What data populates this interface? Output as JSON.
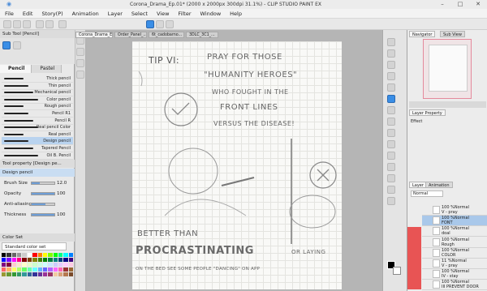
{
  "window": {
    "title": "Corona_Drama_Ep.01* (2000 x 2000px 300dpi 31.1%)  - CLIP STUDIO PAINT EX",
    "controls": [
      "–",
      "□",
      "✕"
    ]
  },
  "menu": [
    "File",
    "Edit",
    "Story(P)",
    "Animation",
    "Layer",
    "Select",
    "View",
    "Filter",
    "Window",
    "Help"
  ],
  "left_panel": {
    "header": "Sub Tool [Pencil]",
    "tabs": [
      "Pencil",
      "Pastel"
    ],
    "brushes": [
      "Thick pencil",
      "Thin pencil",
      "Mechanical pencil",
      "Color pencil",
      "Rough pencil",
      "Pencil R1",
      "Pencil R",
      "Real pencil Color",
      "Real pencil",
      "Design pencil",
      "Tapered Pencil",
      "Oil B. Pencil"
    ],
    "tool_property_header": "Tool property [Design pe...",
    "tool_property_name": "Design pencil",
    "properties": [
      {
        "label": "Brush Size",
        "value": "12.0",
        "fill": 0.35
      },
      {
        "label": "Opacity",
        "value": "100",
        "fill": 1.0
      },
      {
        "label": "Anti-aliasing",
        "value": "",
        "fill": 0.6
      },
      {
        "label": "Thickness",
        "value": "100",
        "fill": 1.0
      }
    ],
    "color_set_header": "Color Set",
    "color_set_value": "Standard color set",
    "swatch_colors": [
      "#000000",
      "#333333",
      "#666666",
      "#999999",
      "#cccccc",
      "#ffffff",
      "#ff0000",
      "#ff8000",
      "#ffff00",
      "#80ff00",
      "#00ff00",
      "#00ff80",
      "#00ffff",
      "#0080ff",
      "#0000ff",
      "#8000ff",
      "#ff00ff",
      "#ff0080",
      "#800000",
      "#804000",
      "#808000",
      "#408000",
      "#008000",
      "#008040",
      "#008080",
      "#004080",
      "#000080",
      "#400080",
      "#800080",
      "#800040",
      "#ffcccc",
      "#ffe5cc",
      "#ffffcc",
      "#e5ffcc",
      "#ccffcc",
      "#ccffe5",
      "#ccffff",
      "#cce5ff",
      "#ccccff",
      "#e5ccff",
      "#ffccff",
      "#ffcce5",
      "#ff6666",
      "#ffb266",
      "#ffff66",
      "#b2ff66",
      "#66ff66",
      "#66ffb2",
      "#66ffff",
      "#66b2ff",
      "#6666ff",
      "#b266ff",
      "#ff66ff",
      "#ff66b2",
      "#993333",
      "#996633",
      "#999933",
      "#669933",
      "#339933",
      "#339966",
      "#339999",
      "#336699",
      "#333399",
      "#663399",
      "#993399",
      "#993366",
      "#f2c9a0",
      "#d9a27a",
      "#b5784f",
      "#7a4a2b"
    ]
  },
  "doc_tabs": [
    "Corona_Drama_Ep.01*",
    "Order_Panel_...",
    "6t_cadobarno...",
    "3DLC_3C1_..."
  ],
  "canvas_text": {
    "tip": "TIP VI:",
    "line1": "PRAY FOR THOSE",
    "line2": "\"HUMANITY HEROES\"",
    "line3": "WHO FOUGHT IN THE",
    "line4": "FRONT LINES",
    "line5": "VERSUS THE DISEASE!",
    "line6": "BETTER THAN",
    "line7": "PROCRASTINATING",
    "line8": "OR LAYING",
    "line9": "ON THE BED SEE SOME PEOPLE \"DANCING\" ON APP"
  },
  "right_panel": {
    "nav_tabs": [
      "Navigator",
      "Sub View"
    ],
    "layer_property_tab": "Layer Property",
    "effect_label": "Effect",
    "layer_tabs": [
      "Layer",
      "Animation"
    ],
    "blend_mode": "Normal",
    "layers": [
      {
        "name": "100 %Normal\nV - pray",
        "selected": false
      },
      {
        "name": "100 %Normal\nFONT",
        "selected": true
      },
      {
        "name": "100 %Normal\ndoal",
        "selected": false
      },
      {
        "name": "100 %Normal\nRough",
        "selected": false
      },
      {
        "name": "100 %Normal\nCOLOR",
        "selected": false
      },
      {
        "name": "11 %Normal\nV - pray",
        "selected": false
      },
      {
        "name": "100 %Normal\nIV - stay",
        "selected": false
      },
      {
        "name": "100 %Normal\nIII PREVENT DOOR",
        "selected": false
      }
    ]
  },
  "colors": {
    "accent": "#3a8ee6",
    "selection": "#b9d3ef",
    "nav_border": "#e48a9c",
    "red_swatch": "#e85454"
  }
}
